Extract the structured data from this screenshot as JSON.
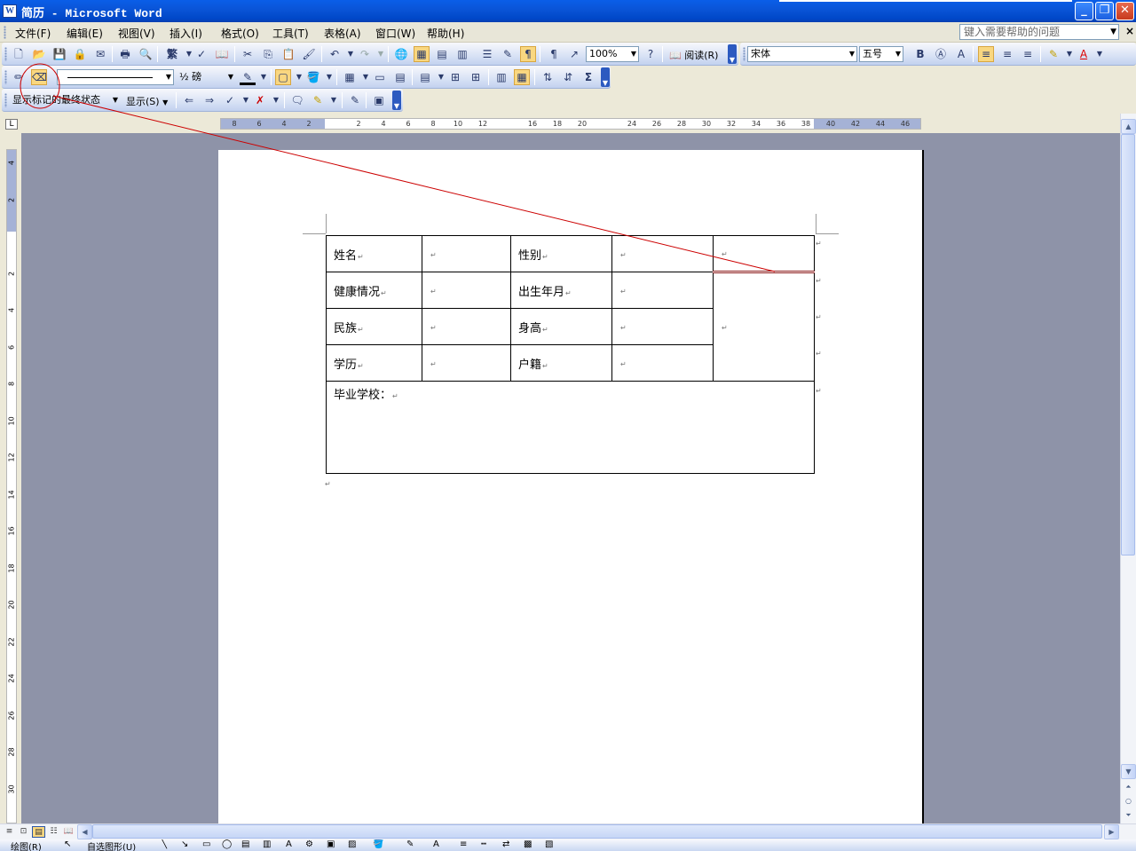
{
  "window": {
    "title": "简历 - Microsoft Word",
    "app_icon_glyph": "W",
    "minimize_glyph": "_",
    "maximize_glyph": "❐",
    "close_glyph": "✕"
  },
  "menu": {
    "items": [
      "文件(F)",
      "编辑(E)",
      "视图(V)",
      "插入(I)",
      "格式(O)",
      "工具(T)",
      "表格(A)",
      "窗口(W)",
      "帮助(H)"
    ],
    "help_placeholder": "键入需要帮助的问题",
    "close_doc_glyph": "×"
  },
  "standard_toolbar": {
    "traditional_chinese": "繁",
    "zoom": "100%",
    "read_label": "阅读(R)"
  },
  "formatting_toolbar": {
    "font_name": "宋体",
    "font_size": "五号",
    "bold": "B",
    "font_color_glyph": "A"
  },
  "tables_borders_toolbar": {
    "line_weight": "½ 磅",
    "autosum": "Σ"
  },
  "reviewing_toolbar": {
    "display_state": "显示标记的最终状态",
    "show_label": "显示(S)"
  },
  "ruler": {
    "corner_glyph": "L",
    "h_labels": [
      "8",
      "6",
      "4",
      "2",
      "",
      "2",
      "4",
      "6",
      "8",
      "10",
      "12",
      "",
      "16",
      "18",
      "20",
      "",
      "24",
      "26",
      "28",
      "30",
      "32",
      "34",
      "36",
      "38",
      "40",
      "42",
      "44",
      "46"
    ],
    "v_labels": [
      "4",
      "2",
      "",
      "2",
      "4",
      "6",
      "8",
      "10",
      "12",
      "14",
      "16",
      "18",
      "20",
      "22",
      "24",
      "26",
      "28",
      "30"
    ]
  },
  "document": {
    "table": {
      "rows": [
        [
          "姓名",
          "",
          "性别",
          ""
        ],
        [
          "健康情况",
          "",
          "出生年月",
          ""
        ],
        [
          "民族",
          "",
          "身高",
          ""
        ],
        [
          "学历",
          "",
          "户籍",
          ""
        ]
      ],
      "school_label": "毕业学校：",
      "paragraph_mark": "↵"
    }
  },
  "status": {
    "draw_label": "绘图(R)",
    "autoshapes_label": "自选图形(U)"
  },
  "colors": {
    "title_bar": "#0a55d8",
    "workspace": "#8e93a8",
    "annotation_red": "#cc0000",
    "active_button": "#f9d780"
  }
}
